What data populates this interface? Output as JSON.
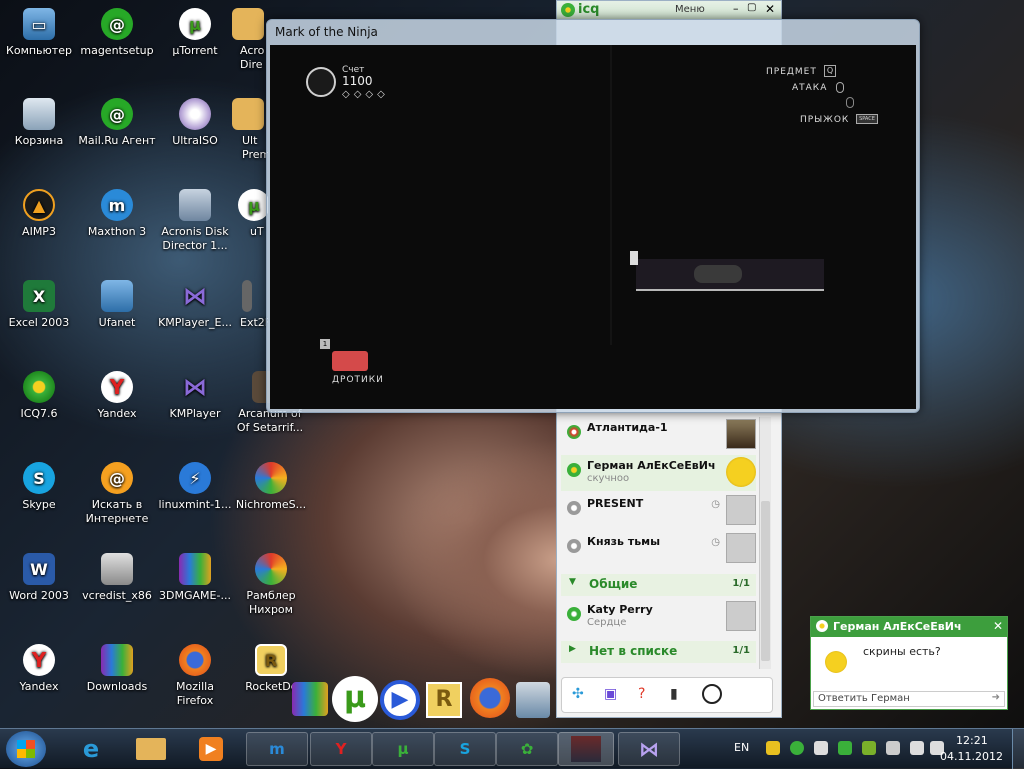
{
  "desktop_icons": {
    "computer": "Компьютер",
    "magentsetup": "magentsetup",
    "utorrent": "µTorrent",
    "acronis_top": "Acro\nDire",
    "recycle_bin": "Корзина",
    "mailru": "Mail.Ru Агент",
    "ultraiso": "UltraISO",
    "ultra_prem": "Ult\nPrem",
    "aimp": "AIMP3",
    "maxthon": "Maxthon 3",
    "acronis": "Acronis Disk\nDirector 1...",
    "ut_partial": "uT",
    "excel": "Excel 2003",
    "ufanet": "Ufanet",
    "kmplayer_e": "KMPlayer_E...",
    "ext2": "Ext2F",
    "icq": "ICQ7.6",
    "yandex_mid": "Yandex",
    "kmplayer": "KMPlayer",
    "arcanum": "Arcanum of\nOf Setarrif...",
    "skype": "Skype",
    "search_inet": "Искать в\nИнтернете",
    "linuxmint": "linuxmint-1...",
    "nichrome": "NichromeS...",
    "word": "Word 2003",
    "vcredist": "vcredist_x86",
    "3dmgame": "3DMGAME-...",
    "rambler": "Рамблер\nНихром",
    "yandex_bottom": "Yandex",
    "downloads": "Downloads",
    "firefox": "Mozilla\nFirefox",
    "rocketdock": "RocketDc"
  },
  "game": {
    "window_title": "Mark of the Ninja",
    "score_label": "Счет",
    "score_value": "1100",
    "controls": {
      "item": "ПРЕДМЕТ",
      "attack": "АТАКА",
      "jump": "ПРЫЖОК",
      "item_key": "Q",
      "jump_key": "SPACE"
    },
    "item_slot_key": "1",
    "weapon_label": "ДРОТИКИ"
  },
  "icq": {
    "logo": "icq",
    "menu_label": "Меню",
    "contacts": [
      {
        "name": "Атлантида-1",
        "status": ""
      },
      {
        "name": "Герман АлЕкСеЕвИч",
        "status": "скучноо"
      },
      {
        "name": "PRESENT",
        "status": ""
      },
      {
        "name": "Князь тьмы",
        "status": ""
      }
    ],
    "group_general": {
      "name": "Общие",
      "count": "1/1"
    },
    "contact_katy": {
      "name": "Katy Perry",
      "status": "Сердце"
    },
    "group_not_in_list": {
      "name": "Нет в списке",
      "count": "1/1"
    }
  },
  "notification": {
    "sender": "Герман АлЕкСеЕвИч",
    "message": "скрины есть?",
    "reply_placeholder": "Ответить Герман"
  },
  "taskbar": {
    "language": "EN",
    "time": "12:21",
    "date": "04.11.2012"
  }
}
